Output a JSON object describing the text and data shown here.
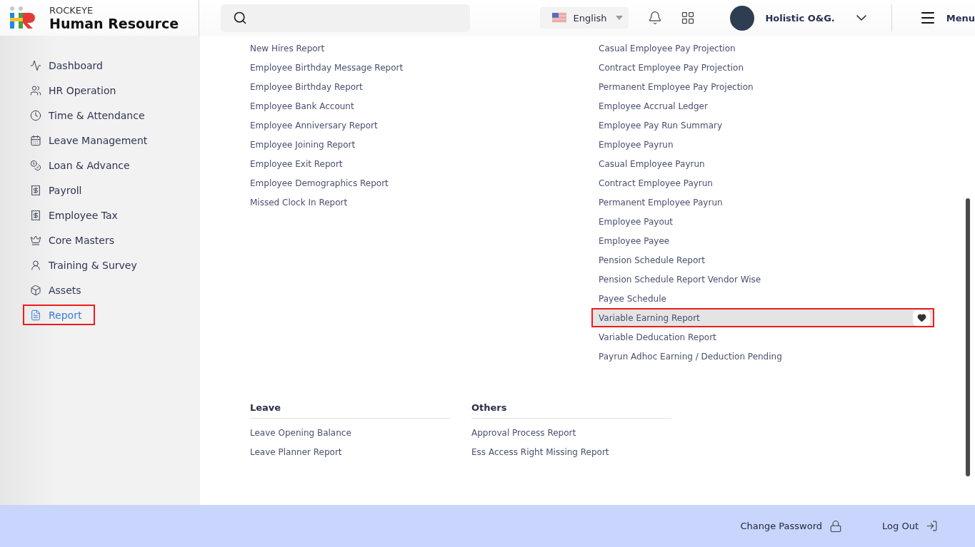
{
  "header": {
    "brand_top": "ROCKEYE",
    "brand": "Human Resource",
    "language": "English",
    "user_name": "Holistic O&G.",
    "menu_label": "Menu"
  },
  "sidebar": {
    "items": [
      {
        "label": "Dashboard",
        "selected": false
      },
      {
        "label": "HR Operation",
        "selected": false
      },
      {
        "label": "Time & Attendance",
        "selected": false
      },
      {
        "label": "Leave Management",
        "selected": false
      },
      {
        "label": "Loan & Advance",
        "selected": false
      },
      {
        "label": "Payroll",
        "selected": false
      },
      {
        "label": "Employee Tax",
        "selected": false
      },
      {
        "label": "Core Masters",
        "selected": false
      },
      {
        "label": "Training & Survey",
        "selected": false
      },
      {
        "label": "Assets",
        "selected": false
      },
      {
        "label": "Report",
        "selected": true
      }
    ]
  },
  "report_columns": [
    {
      "items": [
        {
          "label": "New Hires Report",
          "selected": false
        },
        {
          "label": "Employee Birthday Message Report",
          "selected": false
        },
        {
          "label": "Employee Birthday Report",
          "selected": false
        },
        {
          "label": "Employee Bank Account",
          "selected": false
        },
        {
          "label": "Employee Anniversary Report",
          "selected": false
        },
        {
          "label": "Employee Joining Report",
          "selected": false
        },
        {
          "label": "Employee Exit Report",
          "selected": false
        },
        {
          "label": "Employee Demographics Report",
          "selected": false
        },
        {
          "label": "Missed Clock In Report",
          "selected": false
        }
      ]
    },
    {
      "items": [
        {
          "label": "Casual Employee Pay Projection",
          "selected": false
        },
        {
          "label": "Contract Employee Pay Projection",
          "selected": false
        },
        {
          "label": "Permanent Employee Pay Projection",
          "selected": false
        },
        {
          "label": "Employee Accrual Ledger",
          "selected": false
        },
        {
          "label": "Employee Pay Run Summary",
          "selected": false
        },
        {
          "label": "Employee Payrun",
          "selected": false
        },
        {
          "label": "Casual Employee Payrun",
          "selected": false
        },
        {
          "label": "Contract Employee Payrun",
          "selected": false
        },
        {
          "label": "Permanent Employee Payrun",
          "selected": false
        },
        {
          "label": "Employee Payout",
          "selected": false
        },
        {
          "label": "Employee Payee",
          "selected": false
        },
        {
          "label": "Pension Schedule Report",
          "selected": false
        },
        {
          "label": "Pension Schedule Report Vendor Wise",
          "selected": false
        },
        {
          "label": "Payee Schedule",
          "selected": false
        },
        {
          "label": "Variable Earning Report",
          "selected": true
        },
        {
          "label": "Variable Deducation Report",
          "selected": false
        },
        {
          "label": "Payrun Adhoc Earning / Deduction Pending",
          "selected": false
        }
      ]
    }
  ],
  "sections": [
    {
      "title": "Leave",
      "items": [
        {
          "label": "Leave Opening Balance",
          "selected": false
        },
        {
          "label": "Leave Planner Report",
          "selected": false
        }
      ]
    },
    {
      "title": "Others",
      "items": [
        {
          "label": "Approval Process Report",
          "selected": false
        },
        {
          "label": "Ess Access Right Missing Report",
          "selected": false
        }
      ]
    }
  ],
  "footer": {
    "links": [
      {
        "label": "Change Password"
      },
      {
        "label": "Log Out"
      }
    ]
  }
}
